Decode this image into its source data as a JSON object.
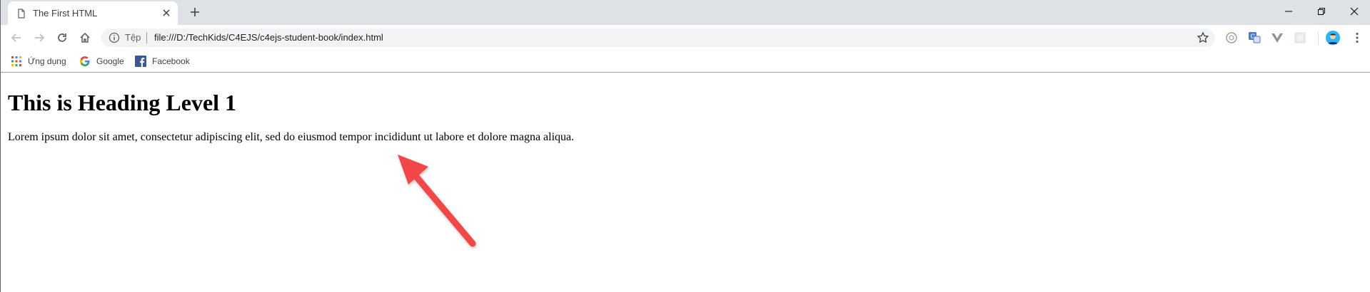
{
  "browser": {
    "tab": {
      "title": "The First HTML"
    },
    "address_bar": {
      "origin_label": "Tệp",
      "url": "file:///D:/TechKids/C4EJS/c4ejs-student-book/index.html"
    },
    "bookmarks": [
      {
        "label": "Ứng dụng",
        "icon": "apps-grid-icon"
      },
      {
        "label": "Google",
        "icon": "google-icon"
      },
      {
        "label": "Facebook",
        "icon": "facebook-icon"
      }
    ]
  },
  "page": {
    "heading": "This is Heading Level 1",
    "paragraph": "Lorem ipsum dolor sit amet, consectetur adipiscing elit, sed do eiusmod tempor incididunt ut labore et dolore magna aliqua."
  },
  "annotation": {
    "arrow_color": "#f24646"
  },
  "colors": {
    "tabstrip": "#dee1e6",
    "omnibox": "#f1f3f4"
  }
}
